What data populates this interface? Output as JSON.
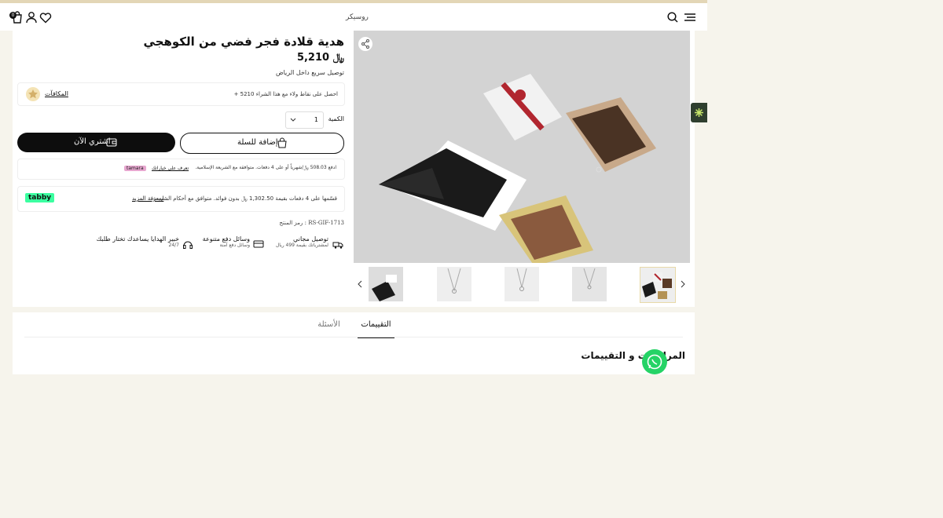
{
  "header": {
    "logo_text": "روسيكر",
    "cart_count": "0",
    "icons": [
      "cart-icon",
      "user-icon",
      "heart-icon",
      "search-icon",
      "menu-icon"
    ]
  },
  "product": {
    "title": "هدية قلادة فجر فضي من الكوهجي",
    "price": "5,210",
    "currency_symbol": "﷼",
    "delivery_note": "توصيل سريع داخل الرياض",
    "rewards": {
      "label": "المكافآت",
      "text": "+ 5210 احصل على نقاط ولاء مع هذا الشراء"
    },
    "quantity_label": "الكمية",
    "quantity_value": "1",
    "add_to_cart_label": "إضافة للسلة",
    "buy_now_label": "اشتري الآن",
    "tamara": {
      "text": "ادفع 508.03 ﷼/شهرياً أو على 4 دفعات. متوافقة مع الشريعة الإسلامية.",
      "link": "تعرف على خياراتك",
      "brand": "tamara"
    },
    "tabby": {
      "text": "قسّمها على 4 دفعات بقيمة 1,302.50 ﷼ بدون فوائد. متوافق مع أحكام الشريعة.",
      "link": "لمعرفة المزيد",
      "brand": "tabby"
    },
    "sku_label": "رمز المنتج : RS-GIF-1713",
    "features": [
      {
        "title": "توصيل مجاني",
        "sub": "لمشترياتك بقيمة 499 ريال"
      },
      {
        "title": "وسائل دفع متنوعة",
        "sub": "وسائل دفع آمنة"
      },
      {
        "title": "خبير الهدايا يساعدك تختار طلبك",
        "sub": "24/7"
      }
    ]
  },
  "tabs": {
    "reviews_tab": "التقييمات",
    "questions_tab": "الأسئلة",
    "reviews_heading": "المراجعات و التقييمات"
  },
  "colors": {
    "accent": "#111111",
    "tabby_green": "#3bffa0",
    "tamara_pink": "#e7a6cf",
    "whatsapp": "#25d366",
    "widget": "#2f3f2f"
  }
}
